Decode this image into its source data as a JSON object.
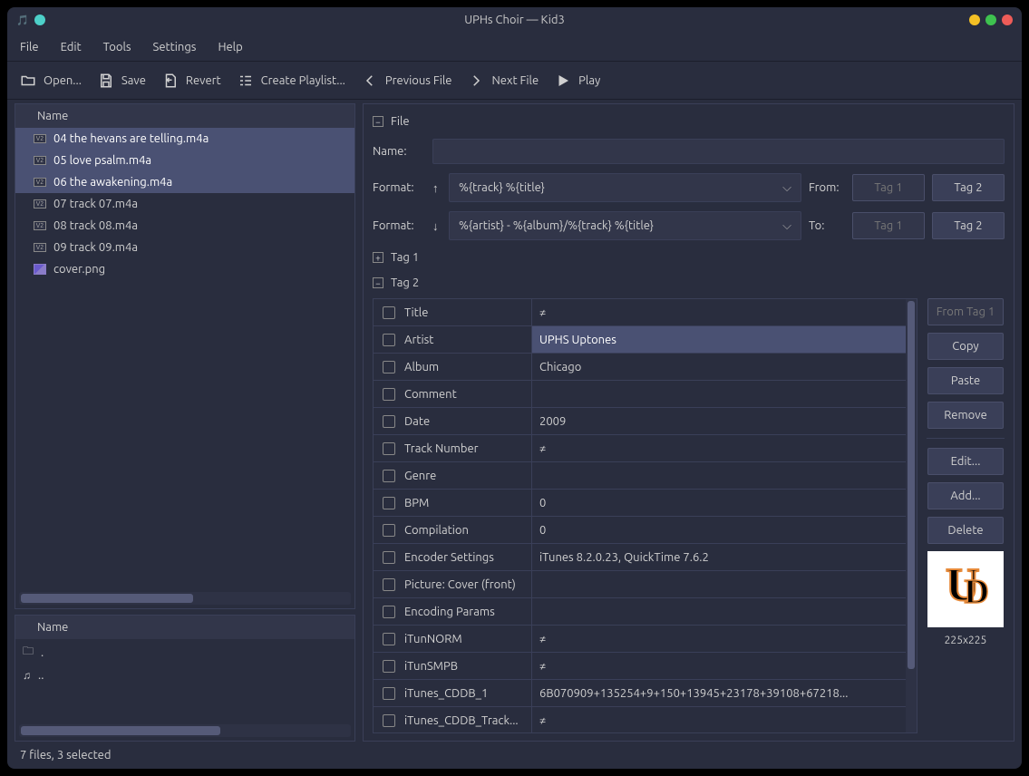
{
  "title": "UPHs Choir — Kid3",
  "menubar": [
    "File",
    "Edit",
    "Tools",
    "Settings",
    "Help"
  ],
  "toolbar": [
    {
      "id": "open",
      "label": "Open...",
      "icon": "folder-icon"
    },
    {
      "id": "save",
      "label": "Save",
      "icon": "save-icon"
    },
    {
      "id": "revert",
      "label": "Revert",
      "icon": "revert-icon"
    },
    {
      "id": "playlist",
      "label": "Create Playlist...",
      "icon": "playlist-icon"
    },
    {
      "id": "prev",
      "label": "Previous File",
      "icon": "chevron-left-icon"
    },
    {
      "id": "next",
      "label": "Next File",
      "icon": "chevron-right-icon"
    },
    {
      "id": "play",
      "label": "Play",
      "icon": "play-icon"
    }
  ],
  "file_list": {
    "header": "Name",
    "items": [
      {
        "name": "04 the hevans are telling.m4a",
        "badge": "V2",
        "selected": true
      },
      {
        "name": "05 love psalm.m4a",
        "badge": "V2",
        "selected": true
      },
      {
        "name": "06 the awakening.m4a",
        "badge": "V2",
        "selected": true
      },
      {
        "name": "07 track 07.m4a",
        "badge": "V2",
        "selected": false
      },
      {
        "name": "08 track 08.m4a",
        "badge": "V2",
        "selected": false
      },
      {
        "name": "09 track 09.m4a",
        "badge": "V2",
        "selected": false
      },
      {
        "name": "cover.png",
        "badge": "img",
        "selected": false
      }
    ]
  },
  "dir_list": {
    "header": "Name",
    "items": [
      {
        "icon": "folder",
        "name": "."
      },
      {
        "icon": "music",
        "name": ".."
      }
    ]
  },
  "file_section": {
    "title": "File",
    "name_label": "Name:",
    "name_value": "",
    "format_label": "Format:",
    "format_up_value": "%{track} %{title}",
    "format_down_value": "%{artist} - %{album}/%{track} %{title}",
    "from_label": "From:",
    "to_label": "To:",
    "tag1_btn": "Tag 1",
    "tag2_btn": "Tag 2"
  },
  "tag1_section": {
    "title": "Tag 1"
  },
  "tag2_section": {
    "title": "Tag 2",
    "fields": [
      {
        "name": "Title",
        "value": "≠",
        "selected": false
      },
      {
        "name": "Artist",
        "value": "UPHS Uptones",
        "selected": true
      },
      {
        "name": "Album",
        "value": "Chicago",
        "selected": false
      },
      {
        "name": "Comment",
        "value": "",
        "selected": false
      },
      {
        "name": "Date",
        "value": "2009",
        "selected": false
      },
      {
        "name": "Track Number",
        "value": "≠",
        "selected": false
      },
      {
        "name": "Genre",
        "value": "",
        "selected": false
      },
      {
        "name": "BPM",
        "value": "0",
        "selected": false
      },
      {
        "name": "Compilation",
        "value": "0",
        "selected": false
      },
      {
        "name": "Encoder Settings",
        "value": "iTunes 8.2.0.23, QuickTime 7.6.2",
        "selected": false
      },
      {
        "name": "Picture: Cover (front)",
        "value": "",
        "selected": false
      },
      {
        "name": "Encoding Params",
        "value": "",
        "selected": false
      },
      {
        "name": "iTunNORM",
        "value": "≠",
        "selected": false
      },
      {
        "name": "iTunSMPB",
        "value": "≠",
        "selected": false
      },
      {
        "name": "iTunes_CDDB_1",
        "value": "6B070909+135254+9+150+13945+23178+39108+67218...",
        "selected": false
      },
      {
        "name": "iTunes_CDDB_Track...",
        "value": "≠",
        "selected": false
      }
    ],
    "buttons": {
      "from_tag1": "From Tag 1",
      "copy": "Copy",
      "paste": "Paste",
      "remove": "Remove",
      "edit": "Edit...",
      "add": "Add...",
      "delete": "Delete"
    },
    "cover_dim": "225x225"
  },
  "status": "7 files, 3 selected"
}
